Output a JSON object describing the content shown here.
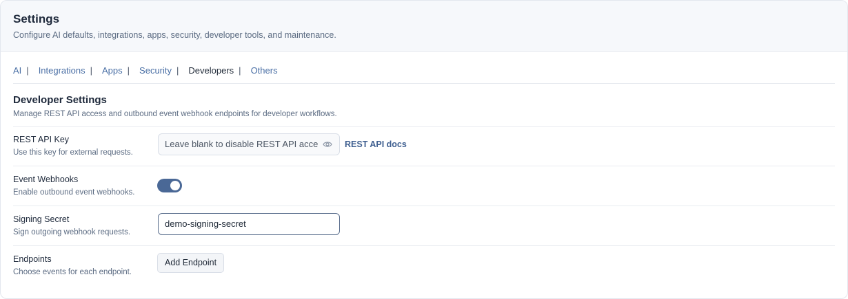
{
  "header": {
    "title": "Settings",
    "subtitle": "Configure AI defaults, integrations, apps, security, developer tools, and maintenance."
  },
  "tabs": [
    {
      "label": "AI",
      "active": false
    },
    {
      "label": "Integrations",
      "active": false
    },
    {
      "label": "Apps",
      "active": false
    },
    {
      "label": "Security",
      "active": false
    },
    {
      "label": "Developers",
      "active": true
    },
    {
      "label": "Others",
      "active": false
    }
  ],
  "tab_separator": "|",
  "section": {
    "title": "Developer Settings",
    "description": "Manage REST API access and outbound event webhook endpoints for developer workflows."
  },
  "rest_api": {
    "label": "REST API Key",
    "help": "Use this key for external requests.",
    "placeholder": "Leave blank to disable REST API access",
    "visibility_icon": "eye-icon",
    "docs_link": "REST API docs"
  },
  "webhooks": {
    "label": "Event Webhooks",
    "help": "Enable outbound event webhooks.",
    "enabled": true
  },
  "signing_secret": {
    "label": "Signing Secret",
    "help": "Sign outgoing webhook requests.",
    "value": "demo-signing-secret"
  },
  "endpoints": {
    "label": "Endpoints",
    "help": "Choose events for each endpoint.",
    "button_label": "Add Endpoint"
  },
  "colors": {
    "accent": "#4a6896",
    "link": "#4a6fa5"
  }
}
